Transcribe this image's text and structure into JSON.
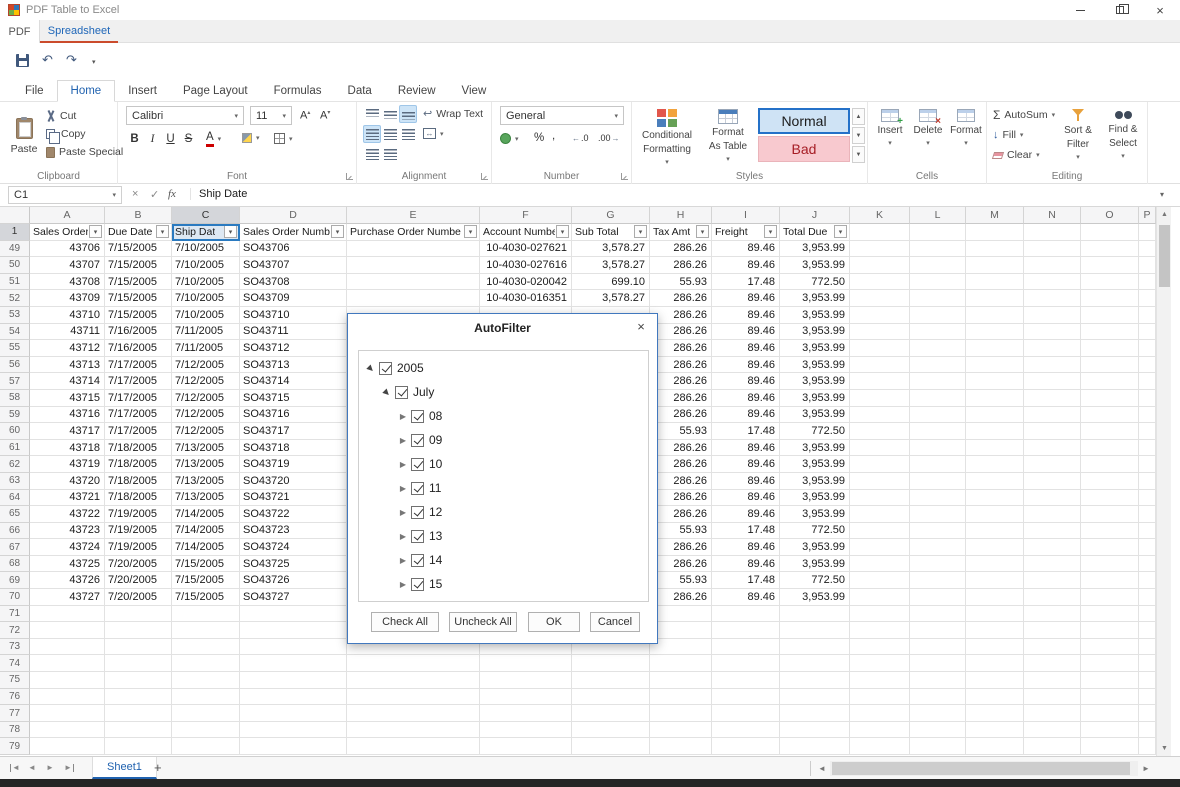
{
  "window": {
    "title": "PDF Table to Excel"
  },
  "app_tabs": {
    "pdf": "PDF",
    "spreadsheet": "Spreadsheet"
  },
  "ribbon": {
    "tabs": [
      {
        "label": "File"
      },
      {
        "label": "Home",
        "active": true
      },
      {
        "label": "Insert"
      },
      {
        "label": "Page Layout"
      },
      {
        "label": "Formulas"
      },
      {
        "label": "Data"
      },
      {
        "label": "Review"
      },
      {
        "label": "View"
      }
    ],
    "clipboard": {
      "label": "Clipboard",
      "paste": "Paste",
      "cut": "Cut",
      "copy": "Copy",
      "paste_special": "Paste Special"
    },
    "font": {
      "label": "Font",
      "family": "Calibri",
      "size": "11",
      "bold": "B",
      "italic": "I",
      "underline": "U",
      "strike": "S",
      "color_letter": "A"
    },
    "alignment": {
      "label": "Alignment",
      "wrap_text": "Wrap Text"
    },
    "number": {
      "label": "Number",
      "format": "General",
      "percent": "%",
      "comma": ",",
      "inc_decimal": ".0",
      "dec_decimal": ".00"
    },
    "styles": {
      "label": "Styles",
      "conditional_1": "Conditional",
      "conditional_2": "Formatting",
      "format_table_1": "Format",
      "format_table_2": "As Table",
      "normal": "Normal",
      "bad": "Bad"
    },
    "cells": {
      "label": "Cells",
      "insert": "Insert",
      "delete": "Delete",
      "format": "Format"
    },
    "editing": {
      "label": "Editing",
      "autosum": "AutoSum",
      "fill": "Fill",
      "clear": "Clear",
      "sort_1": "Sort &",
      "sort_2": "Filter",
      "find_1": "Find &",
      "find_2": "Select"
    },
    "accent_color": "#2062af"
  },
  "formula_bar": {
    "cell_ref": "C1",
    "content": "Ship Date",
    "fx": "fx"
  },
  "sheet": {
    "column_letters": [
      "A",
      "B",
      "C",
      "D",
      "E",
      "F",
      "G",
      "H",
      "I",
      "J",
      "K",
      "L",
      "M",
      "N",
      "O",
      "P"
    ],
    "selected_column": "C",
    "selected_row": 1,
    "headers": [
      "Sales Order I",
      "Due Date",
      "Ship Dat",
      "Sales Order Numbe",
      "Purchase Order Numbe",
      "Account Numbe",
      "Sub Total",
      "Tax Amt",
      "Freight",
      "Total Due"
    ],
    "rows": [
      {
        "n": 49,
        "cells": [
          "43706",
          "7/15/2005",
          "7/10/2005",
          "SO43706",
          "",
          "10-4030-027621",
          "3,578.27",
          "286.26",
          "89.46",
          "3,953.99"
        ]
      },
      {
        "n": 50,
        "cells": [
          "43707",
          "7/15/2005",
          "7/10/2005",
          "SO43707",
          "",
          "10-4030-027616",
          "3,578.27",
          "286.26",
          "89.46",
          "3,953.99"
        ]
      },
      {
        "n": 51,
        "cells": [
          "43708",
          "7/15/2005",
          "7/10/2005",
          "SO43708",
          "",
          "10-4030-020042",
          "699.10",
          "55.93",
          "17.48",
          "772.50"
        ]
      },
      {
        "n": 52,
        "cells": [
          "43709",
          "7/15/2005",
          "7/10/2005",
          "SO43709",
          "",
          "10-4030-016351",
          "3,578.27",
          "286.26",
          "89.46",
          "3,953.99"
        ]
      },
      {
        "n": 53,
        "cells": [
          "43710",
          "7/15/2005",
          "7/10/2005",
          "SO43710",
          "",
          "",
          "",
          "286.26",
          "89.46",
          "3,953.99"
        ]
      },
      {
        "n": 54,
        "cells": [
          "43711",
          "7/16/2005",
          "7/11/2005",
          "SO43711",
          "",
          "",
          "",
          "286.26",
          "89.46",
          "3,953.99"
        ]
      },
      {
        "n": 55,
        "cells": [
          "43712",
          "7/16/2005",
          "7/11/2005",
          "SO43712",
          "",
          "",
          "",
          "286.26",
          "89.46",
          "3,953.99"
        ]
      },
      {
        "n": 56,
        "cells": [
          "43713",
          "7/17/2005",
          "7/12/2005",
          "SO43713",
          "",
          "",
          "",
          "286.26",
          "89.46",
          "3,953.99"
        ]
      },
      {
        "n": 57,
        "cells": [
          "43714",
          "7/17/2005",
          "7/12/2005",
          "SO43714",
          "",
          "",
          "",
          "286.26",
          "89.46",
          "3,953.99"
        ]
      },
      {
        "n": 58,
        "cells": [
          "43715",
          "7/17/2005",
          "7/12/2005",
          "SO43715",
          "",
          "",
          "",
          "286.26",
          "89.46",
          "3,953.99"
        ]
      },
      {
        "n": 59,
        "cells": [
          "43716",
          "7/17/2005",
          "7/12/2005",
          "SO43716",
          "",
          "",
          "",
          "286.26",
          "89.46",
          "3,953.99"
        ]
      },
      {
        "n": 60,
        "cells": [
          "43717",
          "7/17/2005",
          "7/12/2005",
          "SO43717",
          "",
          "",
          "",
          "55.93",
          "17.48",
          "772.50"
        ]
      },
      {
        "n": 61,
        "cells": [
          "43718",
          "7/18/2005",
          "7/13/2005",
          "SO43718",
          "",
          "",
          "",
          "286.26",
          "89.46",
          "3,953.99"
        ]
      },
      {
        "n": 62,
        "cells": [
          "43719",
          "7/18/2005",
          "7/13/2005",
          "SO43719",
          "",
          "",
          "",
          "286.26",
          "89.46",
          "3,953.99"
        ]
      },
      {
        "n": 63,
        "cells": [
          "43720",
          "7/18/2005",
          "7/13/2005",
          "SO43720",
          "",
          "",
          "",
          "286.26",
          "89.46",
          "3,953.99"
        ]
      },
      {
        "n": 64,
        "cells": [
          "43721",
          "7/18/2005",
          "7/13/2005",
          "SO43721",
          "",
          "",
          "",
          "286.26",
          "89.46",
          "3,953.99"
        ]
      },
      {
        "n": 65,
        "cells": [
          "43722",
          "7/19/2005",
          "7/14/2005",
          "SO43722",
          "",
          "",
          "",
          "286.26",
          "89.46",
          "3,953.99"
        ]
      },
      {
        "n": 66,
        "cells": [
          "43723",
          "7/19/2005",
          "7/14/2005",
          "SO43723",
          "",
          "",
          "",
          "55.93",
          "17.48",
          "772.50"
        ]
      },
      {
        "n": 67,
        "cells": [
          "43724",
          "7/19/2005",
          "7/14/2005",
          "SO43724",
          "",
          "",
          "",
          "286.26",
          "89.46",
          "3,953.99"
        ]
      },
      {
        "n": 68,
        "cells": [
          "43725",
          "7/20/2005",
          "7/15/2005",
          "SO43725",
          "",
          "",
          "",
          "286.26",
          "89.46",
          "3,953.99"
        ]
      },
      {
        "n": 69,
        "cells": [
          "43726",
          "7/20/2005",
          "7/15/2005",
          "SO43726",
          "",
          "",
          "",
          "55.93",
          "17.48",
          "772.50"
        ]
      },
      {
        "n": 70,
        "cells": [
          "43727",
          "7/20/2005",
          "7/15/2005",
          "SO43727",
          "",
          "",
          "",
          "286.26",
          "89.46",
          "3,953.99"
        ]
      }
    ],
    "trailing_empty_rows": [
      71,
      72,
      73,
      74,
      75,
      76,
      77,
      78,
      79
    ],
    "sheet_tab": "Sheet1",
    "add_sheet": "+"
  },
  "dialog": {
    "title": "AutoFilter",
    "tree": [
      {
        "level": 0,
        "expanded": true,
        "checked": true,
        "label": "2005"
      },
      {
        "level": 1,
        "expanded": true,
        "checked": true,
        "label": "July"
      },
      {
        "level": 2,
        "expanded": false,
        "checked": true,
        "label": "08"
      },
      {
        "level": 2,
        "expanded": false,
        "checked": true,
        "label": "09"
      },
      {
        "level": 2,
        "expanded": false,
        "checked": true,
        "label": "10"
      },
      {
        "level": 2,
        "expanded": false,
        "checked": true,
        "label": "11"
      },
      {
        "level": 2,
        "expanded": false,
        "checked": true,
        "label": "12"
      },
      {
        "level": 2,
        "expanded": false,
        "checked": true,
        "label": "13"
      },
      {
        "level": 2,
        "expanded": false,
        "checked": true,
        "label": "14"
      },
      {
        "level": 2,
        "expanded": false,
        "checked": true,
        "label": "15"
      }
    ],
    "buttons": {
      "check_all": "Check All",
      "uncheck_all": "Uncheck All",
      "ok": "OK",
      "cancel": "Cancel"
    },
    "border_color": "#4178be"
  }
}
